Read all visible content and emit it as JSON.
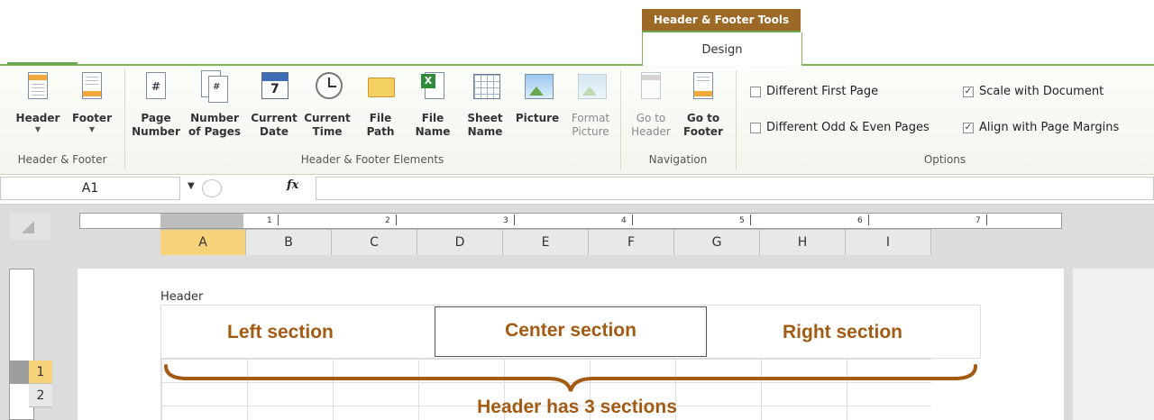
{
  "ribbon": {
    "contextual_tab_title": "Header & Footer Tools",
    "active_tab": "Design",
    "groups": {
      "header_footer": {
        "label": "Header & Footer",
        "header_button": "Header",
        "footer_button": "Footer"
      },
      "elements": {
        "label": "Header & Footer Elements",
        "page_number": [
          "Page",
          "Number"
        ],
        "number_of_pages": [
          "Number",
          "of Pages"
        ],
        "current_date": [
          "Current",
          "Date"
        ],
        "current_time": [
          "Current",
          "Time"
        ],
        "file_path": [
          "File",
          "Path"
        ],
        "file_name": [
          "File",
          "Name"
        ],
        "sheet_name": [
          "Sheet",
          "Name"
        ],
        "picture": "Picture",
        "format_picture": [
          "Format",
          "Picture"
        ]
      },
      "navigation": {
        "label": "Navigation",
        "go_to_header": [
          "Go to",
          "Header"
        ],
        "go_to_footer": [
          "Go to",
          "Footer"
        ]
      },
      "options": {
        "label": "Options",
        "different_first_page": {
          "label": "Different First Page",
          "checked": false
        },
        "different_odd_even": {
          "label": "Different Odd & Even Pages",
          "checked": false
        },
        "scale_with_document": {
          "label": "Scale with Document",
          "checked": true
        },
        "align_with_margins": {
          "label": "Align with Page Margins",
          "checked": true
        }
      }
    }
  },
  "formula_bar": {
    "name_box": "A1",
    "fx_label": "fx",
    "formula": ""
  },
  "ruler_marks": [
    "1",
    "2",
    "3",
    "4",
    "5",
    "6",
    "7"
  ],
  "sheet": {
    "columns": [
      "A",
      "B",
      "C",
      "D",
      "E",
      "F",
      "G",
      "H",
      "I"
    ],
    "selected_column": "A",
    "rows": [
      "1",
      "2"
    ],
    "selected_row": "1",
    "header_label": "Header",
    "sections": {
      "left": "Left section",
      "center": "Center section",
      "right": "Right section"
    },
    "caption": "Header has 3 sections"
  },
  "colors": {
    "contextual_tab": "#9c6a26",
    "ribbon_accent": "#7cb65b",
    "annotation": "#a35a12",
    "selection": "#f6d27a"
  }
}
